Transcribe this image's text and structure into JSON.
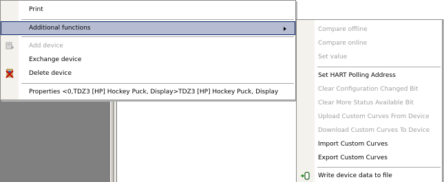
{
  "main_menu": {
    "items": [
      {
        "label": "Print",
        "enabled": true
      },
      {
        "label": "Additional functions",
        "enabled": true,
        "highlighted": true,
        "has_submenu": true
      },
      {
        "label": "Add device",
        "enabled": false,
        "icon": "add-device-icon"
      },
      {
        "label": "Exchange device",
        "enabled": true
      },
      {
        "label": "Delete device",
        "enabled": true,
        "icon": "delete-device-icon"
      },
      {
        "label": "Properties <0,TDZ3 [HP] Hockey Puck, Display>TDZ3 [HP] Hockey Puck, Display",
        "enabled": true
      }
    ]
  },
  "submenu": {
    "items": [
      {
        "label": "Compare offline",
        "enabled": false
      },
      {
        "label": "Compare online",
        "enabled": false
      },
      {
        "label": "Set value",
        "enabled": false
      },
      {
        "label": "Set HART Polling Address",
        "enabled": true
      },
      {
        "label": "Clear Configuration Changed Bit",
        "enabled": false
      },
      {
        "label": "Clear More Status Available Bit",
        "enabled": false
      },
      {
        "label": "Upload Custom Curves From Device",
        "enabled": false
      },
      {
        "label": "Download Custom Curves To Device",
        "enabled": false
      },
      {
        "label": "Import Custom Curves",
        "enabled": true
      },
      {
        "label": "Export Custom Curves",
        "enabled": true
      },
      {
        "label": "Write device data to file",
        "enabled": true,
        "icon": "write-data-icon"
      }
    ]
  },
  "colors": {
    "highlight_bg": "#b6bdd2",
    "highlight_border": "#0a246a",
    "disabled_text": "#a0a0a0",
    "background_panel": "#808080"
  }
}
